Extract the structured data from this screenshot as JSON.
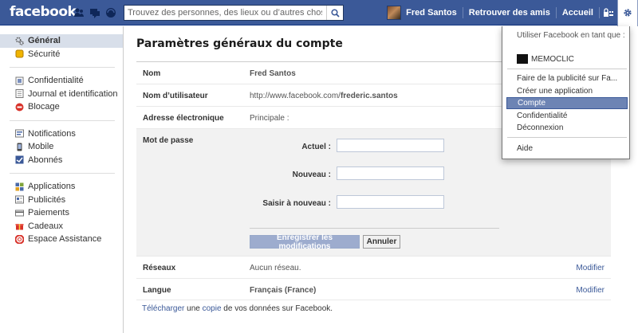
{
  "topbar": {
    "logo": "facebook",
    "search_placeholder": "Trouvez des personnes, des lieux ou d’autres choses",
    "user_name": "Fred Santos",
    "find_friends": "Retrouver des amis",
    "home": "Accueil",
    "icons": [
      "friend-requests-icon",
      "messages-icon",
      "notifications-icon",
      "search-icon",
      "privacy-shortcuts-icon",
      "gear-icon"
    ]
  },
  "sidebar": {
    "groups": [
      [
        {
          "label": "Général",
          "icon": "gear-icon",
          "active": true
        },
        {
          "label": "Sécurité",
          "icon": "shield-icon"
        }
      ],
      [
        {
          "label": "Confidentialité",
          "icon": "lock-icon"
        },
        {
          "label": "Journal et identification",
          "icon": "timeline-icon"
        },
        {
          "label": "Blocage",
          "icon": "block-icon"
        }
      ],
      [
        {
          "label": "Notifications",
          "icon": "notifications-icon"
        },
        {
          "label": "Mobile",
          "icon": "mobile-icon"
        },
        {
          "label": "Abonnés",
          "icon": "subscribers-icon"
        }
      ],
      [
        {
          "label": "Applications",
          "icon": "apps-icon"
        },
        {
          "label": "Publicités",
          "icon": "ads-icon"
        },
        {
          "label": "Paiements",
          "icon": "payments-icon"
        },
        {
          "label": "Cadeaux",
          "icon": "gift-icon"
        },
        {
          "label": "Espace Assistance",
          "icon": "help-icon"
        }
      ]
    ]
  },
  "main": {
    "title": "Paramètres généraux du compte",
    "rows": {
      "name": {
        "label": "Nom",
        "value": "Fred Santos"
      },
      "username": {
        "label": "Nom d’utilisateur",
        "value_prefix": "http://www.facebook.com/",
        "value_bold": "frederic.santos"
      },
      "email": {
        "label": "Adresse électronique",
        "value": "Principale :"
      },
      "password": {
        "label": "Mot de passe",
        "current_label": "Actuel :",
        "new_label": "Nouveau :",
        "confirm_label": "Saisir à nouveau :",
        "save_button": "Enregistrer les modifications",
        "cancel_button": "Annuler"
      },
      "networks": {
        "label": "Réseaux",
        "value": "Aucun réseau.",
        "edit": "Modifier"
      },
      "language": {
        "label": "Langue",
        "value": "Français (France)",
        "edit": "Modifier"
      }
    },
    "download": {
      "link1": "Télécharger",
      "mid": " une ",
      "link2": "copie",
      "suffix": " de vos données sur Facebook."
    }
  },
  "dropdown": {
    "use_as": "Utiliser Facebook en tant que :",
    "page_name": "MEMOCLIC",
    "items": [
      "Faire de la publicité sur Fa...",
      "Créer une application",
      "Compte",
      "Confidentialité",
      "Déconnexion"
    ],
    "help": "Aide",
    "highlighted": "Compte"
  },
  "colors": {
    "brand": "#3b5998",
    "highlight": "#6d84b4",
    "active_bg": "#d8dfea"
  }
}
